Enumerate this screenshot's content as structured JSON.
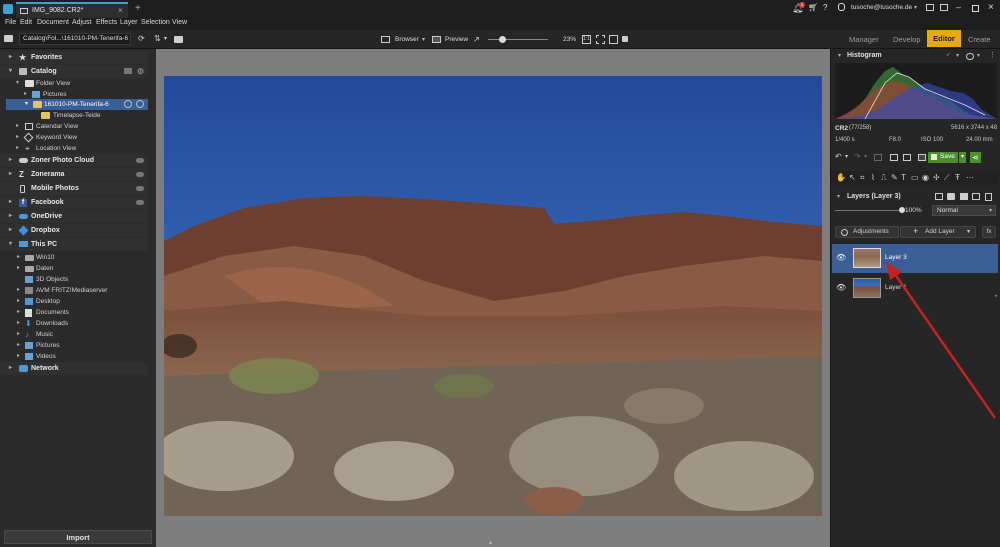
{
  "window": {
    "tab_title": "IMG_9082.CR2*",
    "account": "tusoche@tusoche.de",
    "notification_count": "1"
  },
  "menu": [
    "File",
    "Edit",
    "Document",
    "Adjust",
    "Effects",
    "Layer",
    "Selection",
    "View"
  ],
  "toolbar": {
    "breadcrumb": "Catalog\\Fol...\\161010-PM-Tenerifa-6",
    "browser_label": "Browser",
    "preview_label": "Preview",
    "zoom": "23%"
  },
  "modes": {
    "manager": "Manager",
    "develop": "Develop",
    "editor": "Editor",
    "create": "Create"
  },
  "sidebar": {
    "favorites": "Favorites",
    "catalog": "Catalog",
    "folder_view": "Folder View",
    "pictures": "Pictures",
    "selected_folder": "161010-PM-Tenerifa-6",
    "timelapse": "Timelapse-Teide",
    "calendar_view": "Calendar View",
    "keyword_view": "Keyword View",
    "location_view": "Location View",
    "zoner_cloud": "Zoner Photo Cloud",
    "zonerama": "Zonerama",
    "mobile_photos": "Mobile Photos",
    "facebook": "Facebook",
    "onedrive": "OneDrive",
    "dropbox": "Dropbox",
    "this_pc": "This PC",
    "pc_items": [
      "Win10",
      "Daten",
      "3D Objects",
      "AVM FRITZ!Mediaserver",
      "Desktop",
      "Documents",
      "Downloads",
      "Music",
      "Pictures",
      "Videos"
    ],
    "network": "Network",
    "import": "Import"
  },
  "histogram": {
    "title": "Histogram",
    "format": "CR2",
    "index": "(77/258)",
    "dimensions": "5616 x 3744 x 48",
    "shutter": "1/400 s",
    "aperture": "F8.0",
    "iso": "ISO 100",
    "focal": "24.00 mm"
  },
  "actions": {
    "save": "Save"
  },
  "layers": {
    "title": "Layers (Layer 3)",
    "opacity": "100%",
    "blend_mode": "Normal",
    "adjustments": "Adjustments",
    "add_layer": "Add Layer",
    "fx": "fx",
    "items": [
      "Layer 3",
      "Layer 1"
    ]
  },
  "colors": {
    "accent": "#e8a90f",
    "selected_row": "#3a5f96",
    "save_green": "#4f8f2a"
  }
}
